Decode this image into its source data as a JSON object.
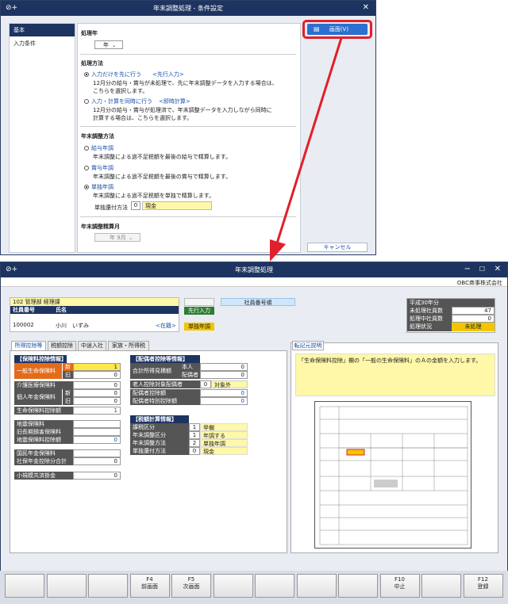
{
  "dialog": {
    "title": "年末調整処理 - 条件設定",
    "side_items": [
      "基本",
      "入力条件"
    ],
    "section_year": "処理年",
    "year_suffix": "年",
    "section_method": "処理方法",
    "method1_label": "入力だけを先に行う",
    "method1_tag": "<先行入力>",
    "method1_desc1": "12月分の給与・賞与が未処理で、先に年末調整データを入力する場合は、",
    "method1_desc2": "こちらを選択します。",
    "method2_label": "入力・計算を同時に行う",
    "method2_tag": "<即時計算>",
    "method2_desc1": "12月分の給与・賞与が処理済で、年末調整データを入力しながら同時に",
    "method2_desc2": "計算する場合は、こちらを選択します。",
    "section_adjust": "年末調整方法",
    "adj1_label": "給与年調",
    "adj1_desc": "年末調整による過不足税額を最後の給与で精算します。",
    "adj2_label": "賞与年調",
    "adj2_desc": "年末調整による過不足税額を最後の賞与で精算します。",
    "adj3_label": "単独年調",
    "adj3_desc": "年末調整による過不足税額を単独で精算します。",
    "refund_label": "単独還付方法",
    "refund_code": "0",
    "refund_value": "現金",
    "section_calc_month": "年末調整精算月",
    "calc_month_suffix": "年  9月",
    "btn_screen": "画面(V)",
    "btn_cancel": "キャンセル"
  },
  "main": {
    "title": "年末調整処理",
    "company": "OBC商事株式会社",
    "dept": "102 管理部 経理課",
    "col_emp_no": "社員番号",
    "col_name": "氏名",
    "emp_no": "100002",
    "emp_name": "小川　いずみ",
    "status_tag": "<在籍>",
    "btn_prior_input": "先行入力",
    "adj_type": "単独年調",
    "order_label": "社員番号順",
    "summary": {
      "year": "平成30年分",
      "rows": [
        {
          "label": "未処理社員数",
          "value": "47"
        },
        {
          "label": "処理中社員数",
          "value": "0"
        },
        {
          "label": "処理状況",
          "value": "未処理"
        }
      ]
    },
    "tabs": [
      "所得控除等",
      "税額控除",
      "中途入社",
      "家族・所得税"
    ],
    "insurance_header": "【保険料控除情報】",
    "life_ins_label": "一般生命保険料",
    "new": "新",
    "old": "旧",
    "life_new": "1",
    "life_old": "0",
    "care_label": "介護医療保険料",
    "care_value": "0",
    "pension_label": "個人年金保険料",
    "pension_new": "0",
    "pension_old": "0",
    "life_deduction_label": "生命保険料控除額",
    "life_deduction_value": "1",
    "quake_label": "地震保険料",
    "old_long_label": "旧長期損害保険料",
    "quake_deduction_label": "地震保険料控除額",
    "quake_deduction_value": "0",
    "national_pension_label": "国民年金保険料",
    "social_total_label": "社保年金控除分合計",
    "social_total_value": "0",
    "small_biz_label": "小規模共済掛金",
    "small_biz_value": "0",
    "spouse_header": "【配偶者控除等情報】",
    "total_income_label": "合計所得見積額",
    "self_label": "本人",
    "self_value": "0",
    "spouse_label": "配偶者",
    "spouse_value": "0",
    "elderly_label": "老人控除対象配偶者",
    "elderly_code": "0",
    "elderly_value": "対象外",
    "spouse_deduct_label": "配偶者控除額",
    "spouse_deduct_value": "0",
    "spouse_special_label": "配偶者特別控除額",
    "spouse_special_value": "0",
    "tax_header": "【税額計算情報】",
    "tax_rows": [
      {
        "label": "課税区分",
        "code": "1",
        "value": "甲欄"
      },
      {
        "label": "年末調整区分",
        "code": "1",
        "value": "年調する"
      },
      {
        "label": "年末調整方法",
        "code": "2",
        "value": "単独年調"
      },
      {
        "label": "単独還付方法",
        "code": "0",
        "value": "現金"
      }
    ],
    "help_title": "転記元説明",
    "help_text": "「生命保険料控除」欄の「一般の生命保険料」のＡの金額を入力します。",
    "fkeys": [
      {
        "num": "",
        "label": ""
      },
      {
        "num": "",
        "label": ""
      },
      {
        "num": "",
        "label": ""
      },
      {
        "num": "F4",
        "label": "前画面"
      },
      {
        "num": "F5",
        "label": "次画面"
      },
      {
        "num": "",
        "label": ""
      },
      {
        "num": "",
        "label": ""
      },
      {
        "num": "",
        "label": ""
      },
      {
        "num": "",
        "label": ""
      },
      {
        "num": "F10",
        "label": "中止"
      },
      {
        "num": "",
        "label": ""
      },
      {
        "num": "F12",
        "label": "登録"
      }
    ]
  }
}
